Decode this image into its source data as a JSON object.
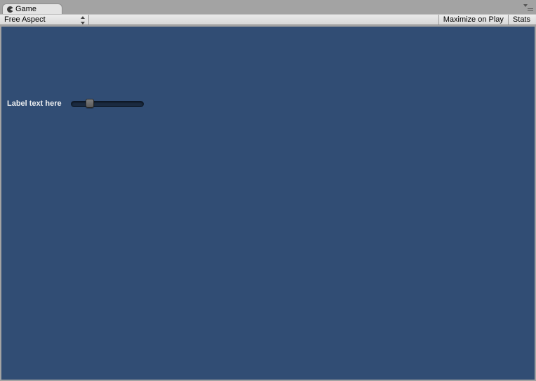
{
  "tab": {
    "title": "Game"
  },
  "toolbar": {
    "aspect_dropdown": {
      "selected": "Free Aspect"
    },
    "maximize_button": "Maximize on Play",
    "stats_button": "Stats"
  },
  "gui": {
    "label_text": "Label text here",
    "slider": {
      "value": 0.25,
      "min": 0,
      "max": 1
    }
  }
}
